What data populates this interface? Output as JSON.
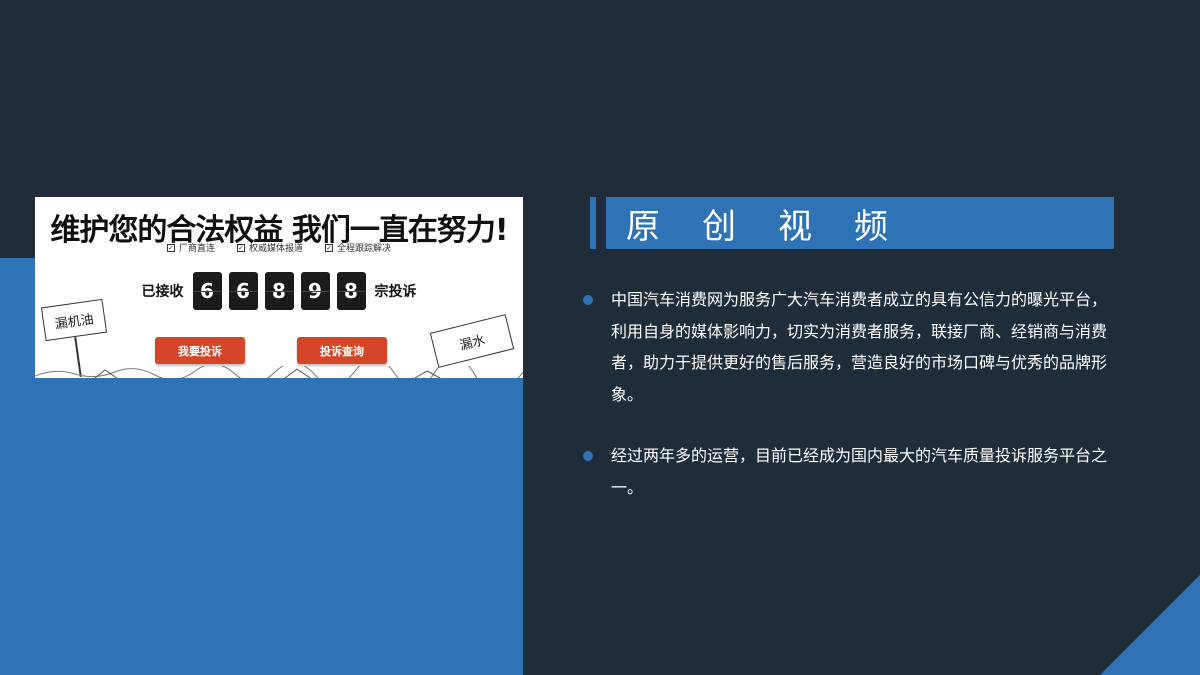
{
  "banner": {
    "headline": "维护您的合法权益   我们一直在努力!",
    "checks": [
      "厂商直连",
      "权威媒体报道",
      "全程跟踪解决"
    ],
    "counter_prefix": "已接收",
    "digits": [
      "6",
      "6",
      "8",
      "9",
      "8"
    ],
    "counter_suffix": "宗投诉",
    "btn_complain": "我要投诉",
    "btn_query": "投诉查询",
    "sign_oil": "漏机油",
    "sign_water": "漏水"
  },
  "section": {
    "title": "原创视频"
  },
  "bullets": [
    "中国汽车消费网为服务广大汽车消费者成立的具有公信力的曝光平台，利用自身的媒体影响力，切实为消费者服务，联接厂商、经销商与消费者，助力于提供更好的售后服务，营造良好的市场口碑与优秀的品牌形象。",
    "经过两年多的运营，目前已经成为国内最大的汽车质量投诉服务平台之一。"
  ],
  "colors": {
    "background": "#1f2d3a",
    "accent_blue": "#2e73b5",
    "button_red": "#d54629"
  }
}
